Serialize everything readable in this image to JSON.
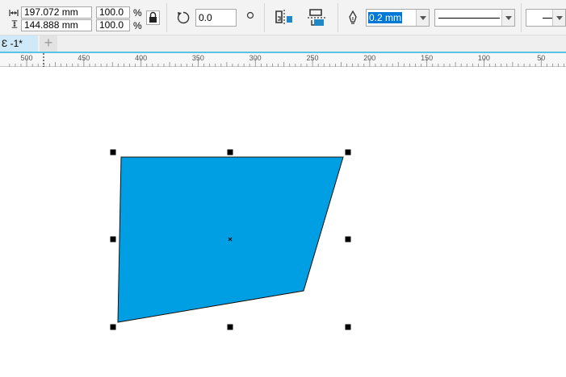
{
  "toolbar": {
    "width_value": "197.072 mm",
    "height_value": "144.888 mm",
    "scale_x": "100.0",
    "scale_y": "100.0",
    "percent_symbol": "%",
    "rotation_value": "0.0",
    "outline_width": "0.2 mm"
  },
  "tabs": {
    "document_tab": "Ɛ -1*",
    "add_tab": "+"
  },
  "ruler": {
    "ticks": [
      "500",
      "450",
      "400",
      "350",
      "300",
      "250",
      "200",
      "150",
      "100",
      "50"
    ]
  },
  "colors": {
    "shape_fill": "#009fe3",
    "accent": "#5bc2e7",
    "selected_text_bg": "#0078d7",
    "icon_blue": "#1e88c8"
  },
  "icons": [
    "width-icon",
    "height-icon",
    "lock-icon",
    "rotate-icon",
    "degree-icon",
    "mirror-horizontal-icon",
    "mirror-vertical-icon",
    "pen-outline-icon"
  ]
}
